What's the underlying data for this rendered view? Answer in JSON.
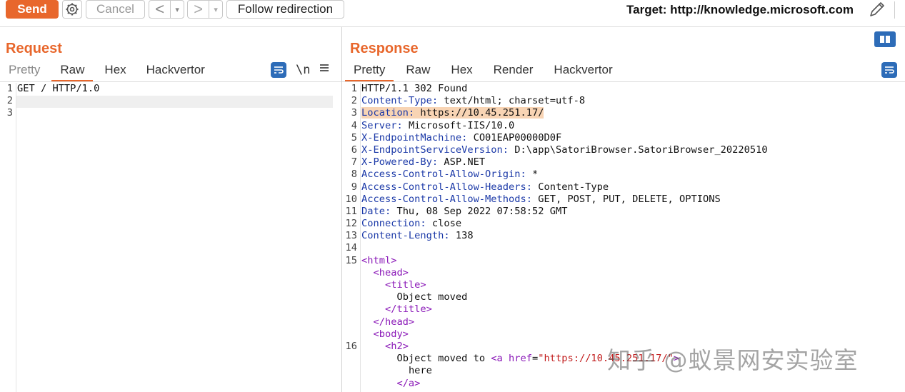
{
  "toolbar": {
    "send_label": "Send",
    "cancel_label": "Cancel",
    "back_symbol": "<",
    "forward_symbol": ">",
    "dropdown_symbol": "▾",
    "follow_label": "Follow redirection",
    "target_text": "Target: http://knowledge.microsoft.com",
    "icons": [
      "gear-icon",
      "pencil-icon"
    ]
  },
  "request": {
    "title": "Request",
    "tabs": [
      "Pretty",
      "Raw",
      "Hex",
      "Hackvertor"
    ],
    "active_tab": "Raw",
    "newline_toggle": "\\n",
    "icons": [
      "wrap-icon",
      "menu-icon"
    ],
    "lines": [
      {
        "n": "1",
        "text": "GET / HTTP/1.0"
      },
      {
        "n": "2",
        "text": ""
      },
      {
        "n": "3",
        "text": ""
      }
    ]
  },
  "response": {
    "title": "Response",
    "tabs": [
      "Pretty",
      "Raw",
      "Hex",
      "Render",
      "Hackvertor"
    ],
    "active_tab": "Pretty",
    "icons": [
      "wrap-icon",
      "layout-toggle-icon"
    ],
    "lines": [
      {
        "n": "1",
        "key": "",
        "sep": "",
        "value": "HTTP/1.1 302 Found"
      },
      {
        "n": "2",
        "key": "Content-Type",
        "sep": ": ",
        "value": "text/html; charset=utf-8"
      },
      {
        "n": "3",
        "key": "Location",
        "sep": ": ",
        "value": "https://10.45.251.17/"
      },
      {
        "n": "4",
        "key": "Server",
        "sep": ": ",
        "value": "Microsoft-IIS/10.0"
      },
      {
        "n": "5",
        "key": "X-EndpointMachine",
        "sep": ": ",
        "value": "CO01EAP00000D0F"
      },
      {
        "n": "6",
        "key": "X-EndpointServiceVersion",
        "sep": ": ",
        "value": "D:\\app\\SatoriBrowser.SatoriBrowser_20220510"
      },
      {
        "n": "7",
        "key": "X-Powered-By",
        "sep": ": ",
        "value": "ASP.NET"
      },
      {
        "n": "8",
        "key": "Access-Control-Allow-Origin",
        "sep": ": ",
        "value": "*"
      },
      {
        "n": "9",
        "key": "Access-Control-Allow-Headers",
        "sep": ": ",
        "value": "Content-Type"
      },
      {
        "n": "10",
        "key": "Access-Control-Allow-Methods",
        "sep": ": ",
        "value": "GET, POST, PUT, DELETE, OPTIONS"
      },
      {
        "n": "11",
        "key": "Date",
        "sep": ": ",
        "value": "Thu, 08 Sep 2022 07:58:52 GMT"
      },
      {
        "n": "12",
        "key": "Connection",
        "sep": ": ",
        "value": "close"
      },
      {
        "n": "13",
        "key": "Content-Length",
        "sep": ": ",
        "value": "138"
      },
      {
        "n": "14",
        "key": "",
        "sep": "",
        "value": ""
      }
    ],
    "html_lines": [
      {
        "n": "15",
        "indent": "",
        "parts": [
          {
            "t": "tag",
            "v": "<html>"
          }
        ]
      },
      {
        "n": "",
        "indent": "  ",
        "parts": [
          {
            "t": "tag",
            "v": "<head>"
          }
        ]
      },
      {
        "n": "",
        "indent": "    ",
        "parts": [
          {
            "t": "tag",
            "v": "<title>"
          }
        ]
      },
      {
        "n": "",
        "indent": "      ",
        "parts": [
          {
            "t": "text",
            "v": "Object moved"
          }
        ]
      },
      {
        "n": "",
        "indent": "    ",
        "parts": [
          {
            "t": "tag",
            "v": "</title>"
          }
        ]
      },
      {
        "n": "",
        "indent": "  ",
        "parts": [
          {
            "t": "tag",
            "v": "</head>"
          }
        ]
      },
      {
        "n": "",
        "indent": "  ",
        "parts": [
          {
            "t": "tag",
            "v": "<body>"
          }
        ]
      },
      {
        "n": "16",
        "indent": "    ",
        "parts": [
          {
            "t": "tag",
            "v": "<h2>"
          }
        ]
      },
      {
        "n": "",
        "indent": "      ",
        "parts": [
          {
            "t": "text",
            "v": "Object moved to "
          },
          {
            "t": "tag",
            "v": "<a"
          },
          {
            "t": "text",
            "v": " "
          },
          {
            "t": "attr",
            "v": "href"
          },
          {
            "t": "text",
            "v": "="
          },
          {
            "t": "str",
            "v": "\"https://10.45.251.17/\""
          },
          {
            "t": "tag",
            "v": ">"
          }
        ]
      },
      {
        "n": "",
        "indent": "        ",
        "parts": [
          {
            "t": "text",
            "v": "here"
          }
        ]
      },
      {
        "n": "",
        "indent": "      ",
        "parts": [
          {
            "t": "tag",
            "v": "</a>"
          }
        ]
      }
    ],
    "highlighted_line": "3"
  },
  "watermark": "知乎 @蚁景网安实验室",
  "colors": {
    "accent": "#e8672c",
    "header_key": "#1c3aa8",
    "html_tag": "#8b1ab8",
    "string": "#c21e1e",
    "highlight": "#f8d4b4",
    "icon_blue": "#2d6cb8"
  }
}
